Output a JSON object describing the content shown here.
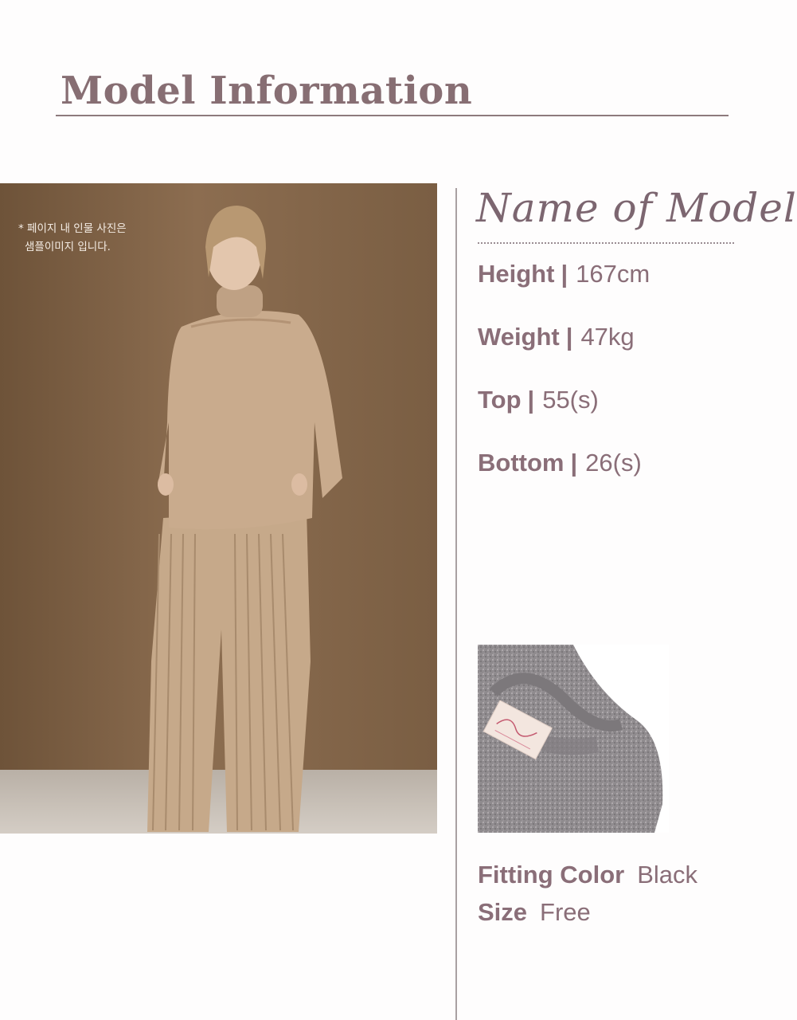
{
  "header": {
    "title": "Model Information"
  },
  "photo": {
    "notice_line1": "* 페이지 내 인물 사진은",
    "notice_line2": "샘플이미지 입니다."
  },
  "model": {
    "name_heading": "Name of Model",
    "specs": [
      {
        "label": "Height",
        "separator": "|",
        "value": "167cm"
      },
      {
        "label": "Weight",
        "separator": "|",
        "value": "47kg"
      },
      {
        "label": "Top",
        "separator": "|",
        "value": "55(s)"
      },
      {
        "label": "Bottom",
        "separator": "|",
        "value": "26(s)"
      }
    ]
  },
  "fitting": {
    "color_label": "Fitting Color",
    "color_value": "Black",
    "size_label": "Size",
    "size_value": "Free"
  },
  "colors": {
    "accent": "#876e73",
    "text": "#8a6e78",
    "rule": "#8d7a7d"
  }
}
